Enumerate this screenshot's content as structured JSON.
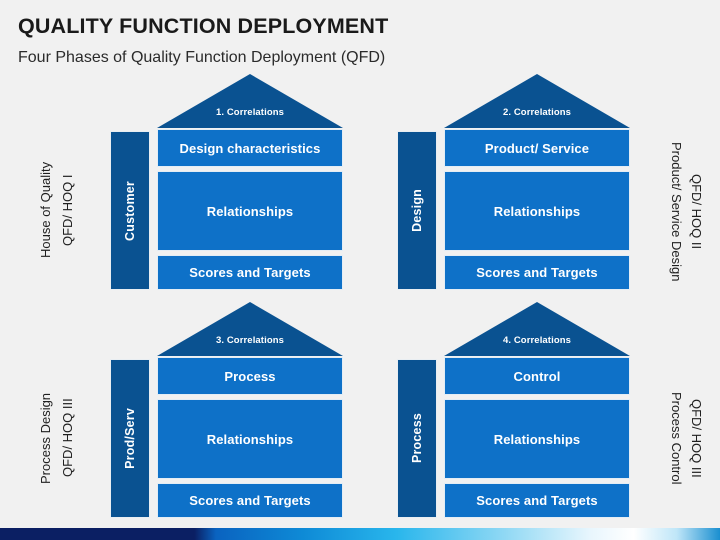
{
  "header": {
    "title": "QUALITY FUNCTION DEPLOYMENT",
    "subtitle": "Four Phases of Quality Function Deployment (QFD)"
  },
  "colors": {
    "background": "#f1f1f1",
    "roof": "#0a5291",
    "sidebar": "#0a5291",
    "block": "#0e71c8",
    "block_text": "#ffffff",
    "title_text": "#1a1a1a"
  },
  "side_labels": {
    "top_left": "House of Quality\nQFD/ HOQ I",
    "top_left_line1": "House of Quality",
    "top_left_line2": "QFD/ HOQ I",
    "top_right_line1": "Product/ Service Design",
    "top_right_line2": "QFD/ HOQ II",
    "bottom_left_line1": "Process Design",
    "bottom_left_line2": "QFD/ HOQ III",
    "bottom_right_line1": "Process Control",
    "bottom_right_line2": "QFD/ HOQ III"
  },
  "houses": [
    {
      "id": "house-1",
      "roof": "1. Correlations",
      "sidebar": "Customer",
      "top": "Design characteristics",
      "middle": "Relationships",
      "bottom": "Scores and Targets"
    },
    {
      "id": "house-2",
      "roof": "2. Correlations",
      "sidebar": "Design",
      "top": "Product/ Service",
      "middle": "Relationships",
      "bottom": "Scores and Targets"
    },
    {
      "id": "house-3",
      "roof": "3. Correlations",
      "sidebar": "Prod/Serv",
      "top": "Process",
      "middle": "Relationships",
      "bottom": "Scores and Targets"
    },
    {
      "id": "house-4",
      "roof": "4. Correlations",
      "sidebar": "Process",
      "top": "Control",
      "middle": "Relationships",
      "bottom": "Scores and Targets"
    }
  ]
}
